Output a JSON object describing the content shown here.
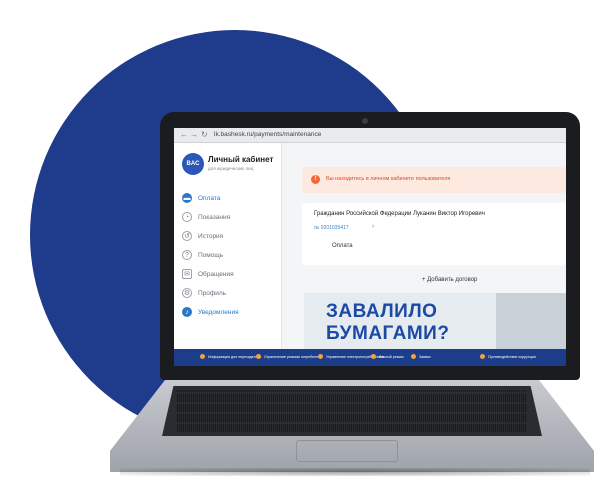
{
  "colors": {
    "brand_blue": "#1e3b8c",
    "accent": "#2b78c8",
    "alert_bg": "#fde9df",
    "alert_text": "#d94b24",
    "footer": "#1c3d8a"
  },
  "browser": {
    "url": "lk.bashesk.ru/payments/maintenance"
  },
  "sidebar": {
    "logo_text": "BAC",
    "title": "Личный кабинет",
    "subtitle": "для юридических лиц",
    "items": [
      {
        "label": "Оплата",
        "icon": "wallet-icon",
        "active": true
      },
      {
        "label": "Показания",
        "icon": "gauge-icon",
        "active": false
      },
      {
        "label": "История",
        "icon": "history-icon",
        "active": false
      },
      {
        "label": "Помощь",
        "icon": "help-icon",
        "active": false
      },
      {
        "label": "Обращения",
        "icon": "mail-icon",
        "active": false
      },
      {
        "label": "Профиль",
        "icon": "profile-icon",
        "active": false
      },
      {
        "label": "Уведомления",
        "icon": "bell-icon",
        "active": true
      }
    ]
  },
  "alert": {
    "text": "Вы находитесь в личном кабинете пользователя"
  },
  "contract": {
    "name": "Гражданин Российской Федерации Луканин Виктор Игоревич",
    "account": "№ 0201035417",
    "payment_label": "Оплата"
  },
  "add_contract": "+ Добавить договор",
  "banner": {
    "line1": "ЗАВАЛИЛО",
    "line2": "БУМАГАМИ?"
  },
  "footer": {
    "items": [
      "Информация для нерезидентов",
      "Ограничение режима потребления",
      "Управление электропотреблением",
      "Личный режим",
      "Заявки",
      "Противодействие коррупции"
    ]
  }
}
